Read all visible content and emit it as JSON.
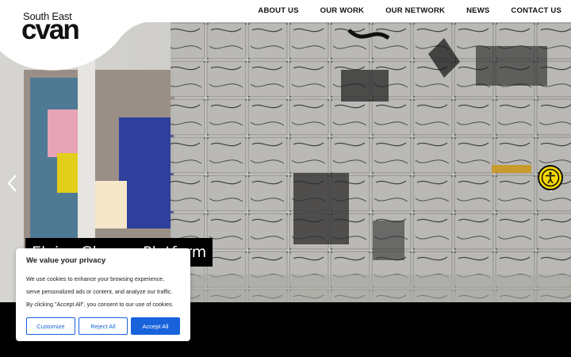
{
  "brand": {
    "line1": "South East",
    "line2": "cvan"
  },
  "nav": {
    "items": [
      {
        "label": "ABOUT US"
      },
      {
        "label": "OUR WORK"
      },
      {
        "label": "OUR NETWORK"
      },
      {
        "label": "NEWS"
      },
      {
        "label": "CONTACT US"
      }
    ]
  },
  "hero": {
    "caption": "Eloise Gleave, Platform",
    "prev_icon": "chevron-left-icon",
    "next_icon": "chevron-right-icon"
  },
  "accessibility": {
    "icon": "accessibility-person-icon",
    "color": "#f6d800"
  },
  "cookie_banner": {
    "title": "We value your privacy",
    "body_lines": [
      "We use cookies to enhance your browsing experience,",
      "serve personalized ads or content, and analyze our traffic.",
      "By clicking \"Accept All\", you consent to our use of cookies."
    ],
    "customize_label": "Customize",
    "reject_label": "Reject All",
    "accept_label": "Accept All",
    "accent_color": "#1863dc"
  }
}
